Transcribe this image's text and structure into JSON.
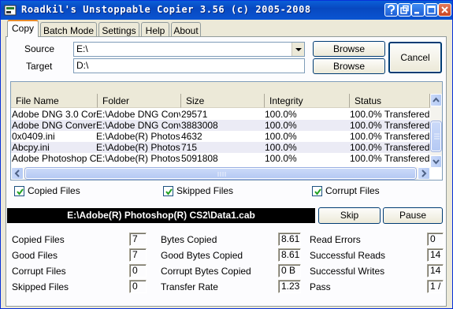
{
  "window": {
    "title": "Roadkil's Unstoppable Copier 3.56 (c) 2005-2008"
  },
  "tabs": [
    {
      "label": "Copy",
      "active": true
    },
    {
      "label": "Batch Mode",
      "active": false
    },
    {
      "label": "Settings",
      "active": false
    },
    {
      "label": "Help",
      "active": false
    },
    {
      "label": "About",
      "active": false
    }
  ],
  "source": {
    "label": "Source",
    "value": "E:\\"
  },
  "target": {
    "label": "Target",
    "value": "D:\\"
  },
  "buttons": {
    "browse_source": "Browse",
    "browse_target": "Browse",
    "cancel": "Cancel",
    "skip": "Skip",
    "pause": "Pause"
  },
  "file_list": {
    "columns": [
      "File Name",
      "Folder",
      "Size",
      "Integrity",
      "Status"
    ],
    "rows": [
      [
        "Adobe DNG 3.0 Cor",
        "E:\\Adobe DNG Conv",
        "29571",
        "100.0%",
        "100.0% Transfered -"
      ],
      [
        "Adobe DNG Convert",
        "E:\\Adobe DNG Conv",
        "3883008",
        "100.0%",
        "100.0% Transfered -"
      ],
      [
        "0x0409.ini",
        "E:\\Adobe(R) Photos",
        "4632",
        "100.0%",
        "100.0% Transfered -"
      ],
      [
        "Abcpy.ini",
        "E:\\Adobe(R) Photos",
        "715",
        "100.0%",
        "100.0% Transfered -"
      ],
      [
        "Adobe Photoshop C",
        "E:\\Adobe(R) Photos",
        "5091808",
        "100.0%",
        "100.0% Transfered -"
      ]
    ]
  },
  "filters": [
    {
      "label": "Copied Files",
      "checked": true
    },
    {
      "label": "Skipped Files",
      "checked": true
    },
    {
      "label": "Corrupt Files",
      "checked": true
    }
  ],
  "current_file": "E:\\Adobe(R) Photoshop(R) CS2\\Data1.cab",
  "stats": {
    "col1": [
      {
        "label": "Copied Files",
        "value": "7"
      },
      {
        "label": "Good Files",
        "value": "7"
      },
      {
        "label": "Corrupt Files",
        "value": "0"
      },
      {
        "label": "Skipped Files",
        "value": "0"
      }
    ],
    "col2": [
      {
        "label": "Bytes Copied",
        "value": "8.61 M"
      },
      {
        "label": "Good Bytes Copied",
        "value": "8.61 M"
      },
      {
        "label": "Corrupt Bytes Copied",
        "value": "0 B"
      },
      {
        "label": "Transfer Rate",
        "value": "1.23 M"
      }
    ],
    "col3": [
      {
        "label": "Read Errors",
        "value": "0"
      },
      {
        "label": "Successful Reads",
        "value": "14"
      },
      {
        "label": "Successful Writes",
        "value": "14"
      },
      {
        "label": "Pass",
        "value": "1 / 7"
      }
    ]
  },
  "colors": {
    "titlebar": "#0a55d2",
    "tab_accent": "#e68b2c",
    "path_bar": "#000000",
    "row_alt": "#ebebf5"
  },
  "icons": {
    "app": "app-icon",
    "title_buttons": [
      "help-icon",
      "restore-icon",
      "minimize-icon",
      "maximize-icon",
      "close-icon"
    ]
  }
}
